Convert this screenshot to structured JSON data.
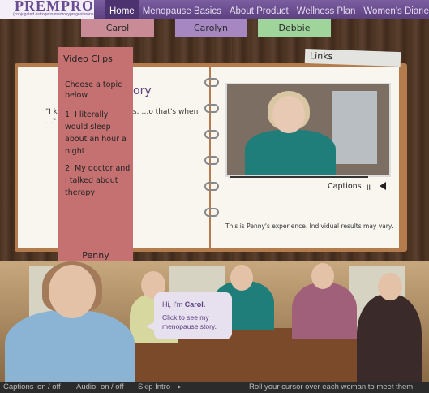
{
  "brand": {
    "name": "PREMPRO",
    "tagline": "(conjugated estrogens/medroxyprogesterone acetate tablets)"
  },
  "nav": {
    "items": [
      "Home",
      "Menopause Basics",
      "About Product",
      "Wellness Plan",
      "Women's Diaries"
    ],
    "active": "Home"
  },
  "tabs": [
    "Carol",
    "Carolyn",
    "Debbie"
  ],
  "links_tab": "Links",
  "notebook": {
    "story_title": "ory",
    "story_text": "\"I ke… o get through this. …o that's when …\"",
    "video_clips": {
      "heading": "Video Clips",
      "intro": "Choose a topic below.",
      "items": [
        "1. I literally would sleep about an hour a night",
        "2. My doctor and I talked about therapy"
      ],
      "footer": "Penny"
    },
    "player": {
      "captions_label": "Captions",
      "pause_glyph": "II"
    },
    "disclaimer": "This is Penny's experience. Individual results may vary."
  },
  "bubble": {
    "greeting": "Hi, I'm",
    "name": "Carol.",
    "line2": "Click to see my menopause story."
  },
  "bottom_bar": {
    "captions_label": "Captions",
    "captions_on": "on",
    "captions_off": "/ off",
    "audio_label": "Audio",
    "audio_on": "on",
    "audio_off": "/ off",
    "skip_intro": "Skip Intro",
    "skip_glyph": "▸",
    "instruction": "Roll your cursor over each woman to meet them"
  },
  "colors": {
    "nav_bg": "#5b3f7e",
    "clip_panel": "#c57171",
    "tab_carol": "#c98b95",
    "tab_carolyn": "#a687c2",
    "tab_debbie": "#9fd59b"
  }
}
